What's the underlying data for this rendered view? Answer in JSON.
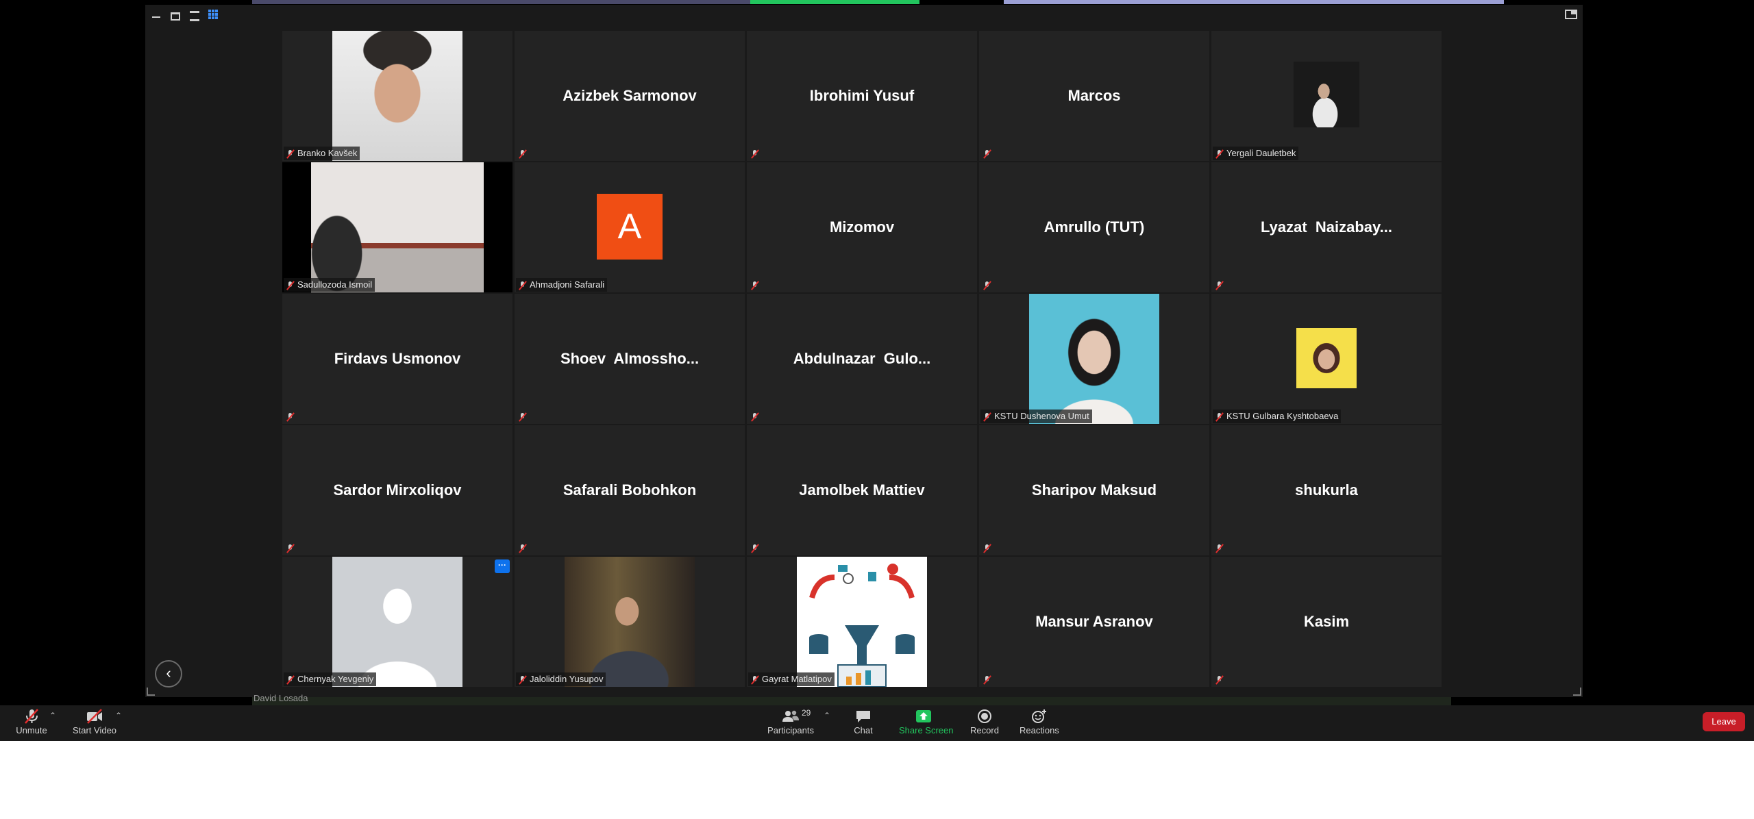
{
  "toolbar": {
    "unmute_label": "Unmute",
    "start_video_label": "Start Video",
    "participants_label": "Participants",
    "participants_count": "29",
    "chat_label": "Chat",
    "share_label": "Share Screen",
    "record_label": "Record",
    "reactions_label": "Reactions",
    "leave_label": "Leave"
  },
  "speaker_name": "David Losada",
  "tiles": [
    {
      "label": "Branko Kavšek"
    },
    {
      "name": "Azizbek Sarmonov"
    },
    {
      "name": "Ibrohimi Yusuf"
    },
    {
      "name": "Marcos"
    },
    {
      "label": "Yergali Dauletbek"
    },
    {
      "label": "Sadullozoda Ismoil"
    },
    {
      "label": "Ahmadjoni Safarali",
      "avatar_letter": "A"
    },
    {
      "name": "Mizomov"
    },
    {
      "name": "Amrullo (TUT)"
    },
    {
      "name": "Lyazat  Naizabay..."
    },
    {
      "name": "Firdavs Usmonov"
    },
    {
      "name": "Shoev  Almossho..."
    },
    {
      "name": "Abdulnazar  Gulo..."
    },
    {
      "label": "KSTU Dushenova Umut"
    },
    {
      "label": "KSTU Gulbara Kyshtobaeva"
    },
    {
      "name": "Sardor Mirxoliqov"
    },
    {
      "name": "Safarali Bobohkon"
    },
    {
      "name": "Jamolbek Mattiev"
    },
    {
      "name": "Sharipov Maksud"
    },
    {
      "name": "shukurla"
    },
    {
      "label": "Chernyak Yevgeniy",
      "more_label": "···"
    },
    {
      "label": "Jaloliddin Yusupov"
    },
    {
      "label": "Gayrat Matlatipov"
    },
    {
      "name": "Mansur Asranov"
    },
    {
      "name": "Kasim"
    }
  ],
  "colors": {
    "accent_blue": "#0e72ed",
    "avatar_orange": "#f04e14",
    "leave_red": "#c81e28",
    "share_green": "#22c55e",
    "mute_red": "#e02d2d"
  },
  "icons": {
    "collapse": "chevron-left-icon"
  }
}
